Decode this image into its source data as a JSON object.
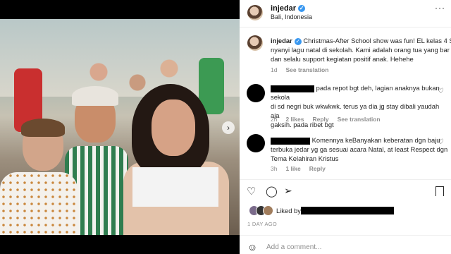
{
  "post": {
    "username": "injedar",
    "location": "Bali, Indonesia",
    "more_icon": "more-horizontal-icon"
  },
  "caption": {
    "username": "injedar",
    "line1": "Christmas-After School show was fun! EL kelas 4 S",
    "line2": "nyanyi lagu natal di sekolah. Kami adalah orang tua yang bar",
    "line3": "dan selalu support kegiatan positif anak. Hehehe",
    "time": "1d",
    "see_translation": "See translation"
  },
  "comments": [
    {
      "line1": "pada repot bgt deh, lagian anaknya bukan sekola",
      "line2": "di sd negri buk wkwkwk. terus ya dia jg stay dibali yaudah aja",
      "line3": "gaksih. pada ribet bgt",
      "time": "2h",
      "likes": "2 likes",
      "reply": "Reply",
      "see_translation": "See translation"
    },
    {
      "line1": "Komennya keBanyakan keberatan dgn baju",
      "line2": "terbuka jedar yg ga sesuai acara Natal, at least Respect dgn",
      "line3": "Tema Kelahiran Kristus",
      "time": "3h",
      "likes": "1 like",
      "reply": "Reply"
    }
  ],
  "actions": {
    "like_icon": "heart-icon",
    "comment_icon": "comment-icon",
    "share_icon": "send-icon",
    "save_icon": "bookmark-icon"
  },
  "likes": {
    "label": "Liked by"
  },
  "timestamp": "1 DAY AGO",
  "add_comment": {
    "placeholder": "Add a comment..."
  },
  "carousel_next": "›"
}
